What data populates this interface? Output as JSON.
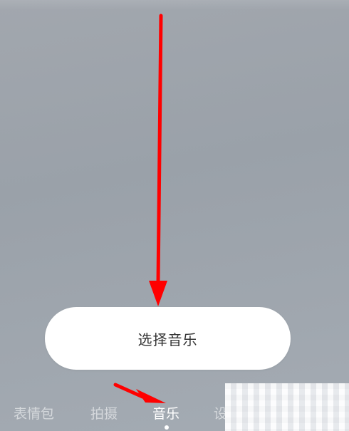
{
  "select_music_button": {
    "label": "选择音乐"
  },
  "tabs": [
    {
      "label": "表情包",
      "active": false
    },
    {
      "label": "拍摄",
      "active": false
    },
    {
      "label": "音乐",
      "active": true
    },
    {
      "label": "设",
      "active": false
    }
  ],
  "colors": {
    "annotation_arrow": "#ff0000",
    "button_background": "#ffffff",
    "button_text": "#333333",
    "active_tab": "#ffffff"
  },
  "icons": {
    "long_arrow": "arrow-down-icon",
    "short_arrow": "arrow-right-icon",
    "privacy_mask": "mosaic-mask"
  }
}
